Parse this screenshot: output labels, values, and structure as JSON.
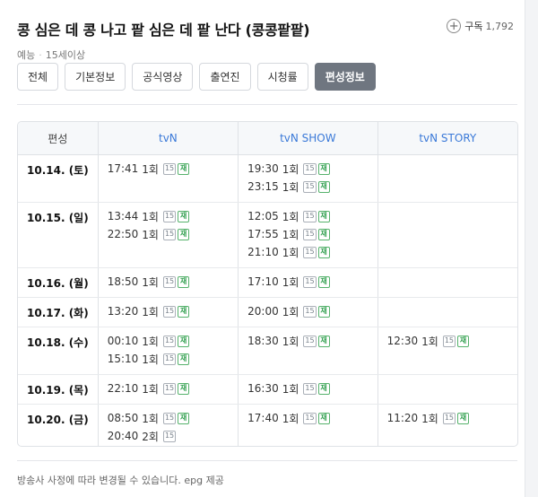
{
  "header": {
    "title": "콩 심은 데 콩 나고 팥 심은 데 팥 난다 (콩콩팥팥)",
    "genre": "예능",
    "rating": "15세이상",
    "subscribe_label": "구독",
    "subscribe_count": "1,792",
    "subscribe_icon": "plus-circle-icon"
  },
  "tabs": [
    {
      "label": "전체",
      "active": false
    },
    {
      "label": "기본정보",
      "active": false
    },
    {
      "label": "공식영상",
      "active": false
    },
    {
      "label": "출연진",
      "active": false
    },
    {
      "label": "시청률",
      "active": false
    },
    {
      "label": "편성정보",
      "active": true
    }
  ],
  "schedule": {
    "headers": [
      "편성",
      "tvN",
      "tvN SHOW",
      "tvN STORY"
    ],
    "rows": [
      {
        "date": "10.14. (토)",
        "channels": [
          [
            {
              "time": "17:41",
              "ep": "1회",
              "age": "15",
              "re": "재"
            }
          ],
          [
            {
              "time": "19:30",
              "ep": "1회",
              "age": "15",
              "re": "재"
            },
            {
              "time": "23:15",
              "ep": "1회",
              "age": "15",
              "re": "재"
            }
          ],
          []
        ]
      },
      {
        "date": "10.15. (일)",
        "channels": [
          [
            {
              "time": "13:44",
              "ep": "1회",
              "age": "15",
              "re": "재"
            },
            {
              "time": "22:50",
              "ep": "1회",
              "age": "15",
              "re": "재"
            }
          ],
          [
            {
              "time": "12:05",
              "ep": "1회",
              "age": "15",
              "re": "재"
            },
            {
              "time": "17:55",
              "ep": "1회",
              "age": "15",
              "re": "재"
            },
            {
              "time": "21:10",
              "ep": "1회",
              "age": "15",
              "re": "재"
            }
          ],
          []
        ]
      },
      {
        "date": "10.16. (월)",
        "channels": [
          [
            {
              "time": "18:50",
              "ep": "1회",
              "age": "15",
              "re": "재"
            }
          ],
          [
            {
              "time": "17:10",
              "ep": "1회",
              "age": "15",
              "re": "재"
            }
          ],
          []
        ]
      },
      {
        "date": "10.17. (화)",
        "channels": [
          [
            {
              "time": "13:20",
              "ep": "1회",
              "age": "15",
              "re": "재"
            }
          ],
          [
            {
              "time": "20:00",
              "ep": "1회",
              "age": "15",
              "re": "재"
            }
          ],
          []
        ]
      },
      {
        "date": "10.18. (수)",
        "channels": [
          [
            {
              "time": "00:10",
              "ep": "1회",
              "age": "15",
              "re": "재"
            },
            {
              "time": "15:10",
              "ep": "1회",
              "age": "15",
              "re": "재"
            }
          ],
          [
            {
              "time": "18:30",
              "ep": "1회",
              "age": "15",
              "re": "재"
            }
          ],
          [
            {
              "time": "12:30",
              "ep": "1회",
              "age": "15",
              "re": "재"
            }
          ]
        ]
      },
      {
        "date": "10.19. (목)",
        "channels": [
          [
            {
              "time": "22:10",
              "ep": "1회",
              "age": "15",
              "re": "재"
            }
          ],
          [
            {
              "time": "16:30",
              "ep": "1회",
              "age": "15",
              "re": "재"
            }
          ],
          []
        ]
      },
      {
        "date": "10.20. (금)",
        "channels": [
          [
            {
              "time": "08:50",
              "ep": "1회",
              "age": "15",
              "re": "재"
            },
            {
              "time": "20:40",
              "ep": "2회",
              "age": "15",
              "re": ""
            }
          ],
          [
            {
              "time": "17:40",
              "ep": "1회",
              "age": "15",
              "re": "재"
            }
          ],
          [
            {
              "time": "11:20",
              "ep": "1회",
              "age": "15",
              "re": "재"
            }
          ]
        ]
      }
    ]
  },
  "footer": {
    "note": "방송사 사정에 따라 변경될 수 있습니다. epg 제공"
  }
}
